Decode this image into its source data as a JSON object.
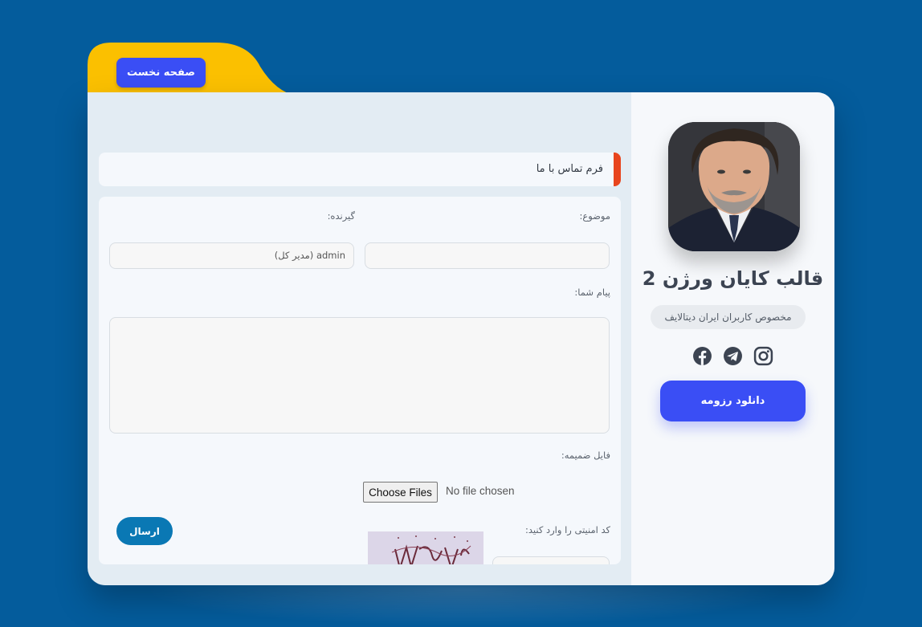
{
  "colors": {
    "page_bg": "#045c9c",
    "accent_blue": "#3a4ef5",
    "tab_yellow": "#fbc000",
    "header_accent": "#e8451d",
    "send_button": "#0a78b4"
  },
  "nav": {
    "home_label": "صفحه نخست"
  },
  "profile": {
    "name": "قالب کایان ورژن 2",
    "subtitle": "مخصوص کاربران ایران دیتالایف",
    "socials": [
      {
        "icon": "facebook-icon"
      },
      {
        "icon": "telegram-icon"
      },
      {
        "icon": "instagram-icon"
      }
    ],
    "download_label": "دانلود رزومه"
  },
  "form": {
    "title": "فرم تماس با ما",
    "subject_label": "موضوع:",
    "subject_value": "",
    "recipient_label": "گیرنده:",
    "recipient_value": "admin (مدیر کل)",
    "message_label": "پیام شما:",
    "message_value": "",
    "attachment_label": "فایل ضمیمه:",
    "choose_files_label": "Choose Files",
    "no_file_text": "No file chosen",
    "security_label": "کد امنیتی را وارد کنید:",
    "security_value": "",
    "send_label": "ارسال"
  }
}
